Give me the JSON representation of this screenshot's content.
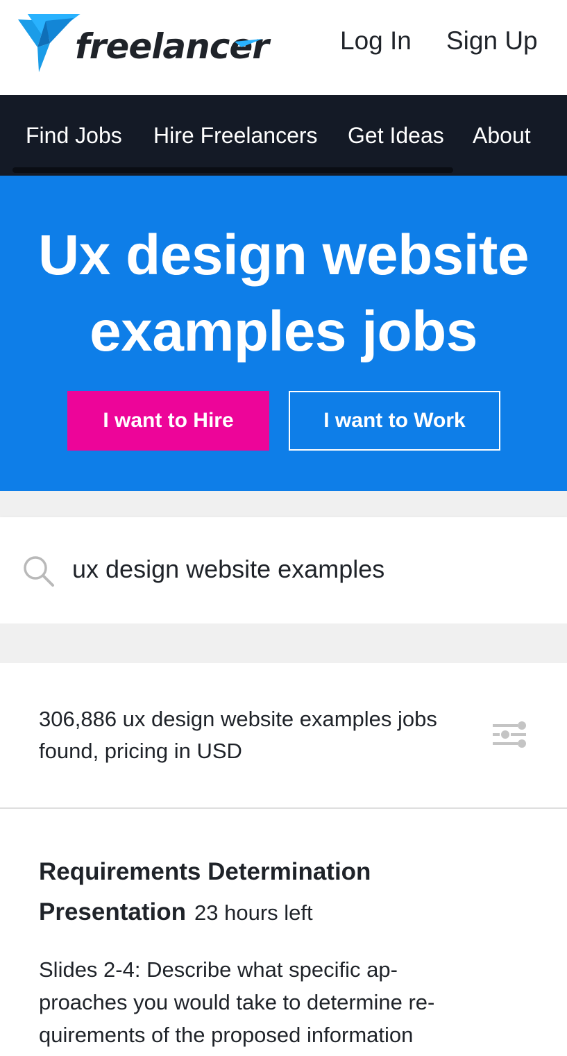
{
  "header": {
    "logo_text": "freelancer",
    "login_label": "Log In",
    "signup_label": "Sign Up"
  },
  "nav": {
    "items": [
      {
        "label": "Find Jobs"
      },
      {
        "label": "Hire Freelancers"
      },
      {
        "label": "Get Ideas"
      },
      {
        "label": "About"
      }
    ]
  },
  "hero": {
    "title_line1": "Ux design website",
    "title_line2": "examples jobs",
    "hire_button": "I want to Hire",
    "work_button": "I want to Work"
  },
  "search": {
    "value": "ux design website examples"
  },
  "results": {
    "line1": "306,886 ux design website examples jobs",
    "line2": "found, pricing in USD"
  },
  "job": {
    "title_line1": "Requirements Determination",
    "title_line2": "Presentation",
    "time_left": "23 hours left",
    "desc_line1": "Slides 2-4: Describe what specific ap-",
    "desc_line2": "proaches you would take to determine re-",
    "desc_line3": "quirements of the proposed information"
  },
  "colors": {
    "brand_blue": "#0e7ee8",
    "hire_pink": "#ed0599",
    "nav_dark": "#141a26",
    "logo_blue": "#29b2fe"
  },
  "icons": [
    "freelancer-logo-icon",
    "search-icon",
    "filter-icon"
  ]
}
